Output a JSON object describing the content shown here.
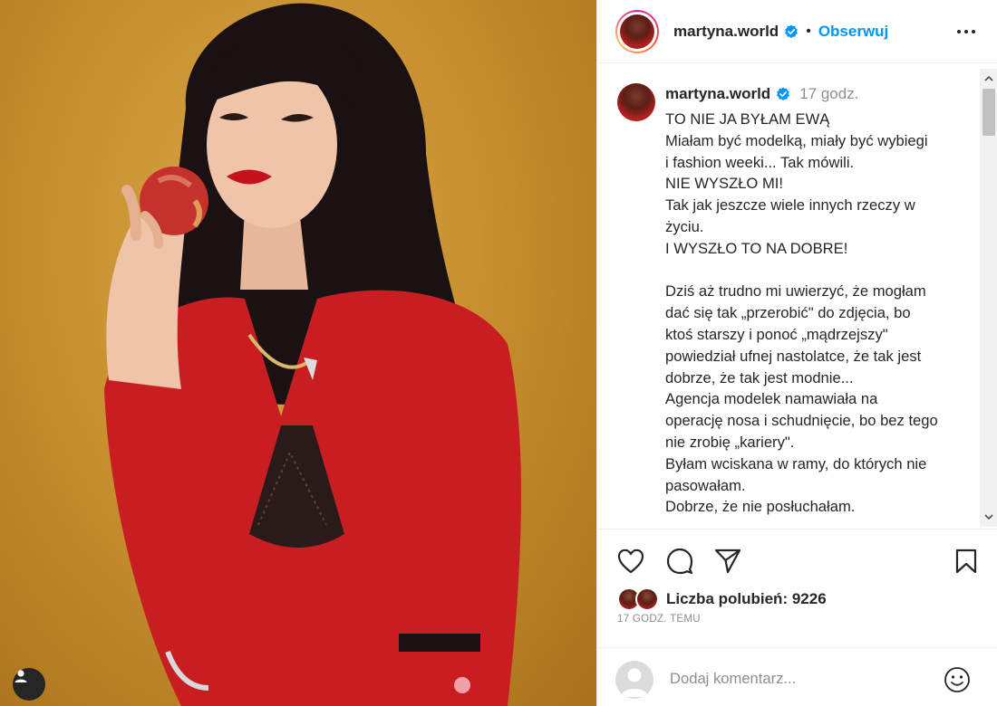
{
  "post": {
    "username": "martyna.world",
    "follow_label": "Obserwuj",
    "separator": "•"
  },
  "caption": {
    "username": "martyna.world",
    "time": "17 godz.",
    "lines": [
      "TO NIE JA BYŁAM EWĄ",
      "Miałam być modelką, miały być wybiegi",
      "i fashion weeki... Tak mówili.",
      "NIE WYSZŁO MI!",
      "Tak jak jeszcze wiele innych rzeczy w",
      "życiu.",
      "I WYSZŁO TO NA DOBRE!",
      "",
      "Dziś aż trudno mi uwierzyć, że mogłam",
      "dać się tak „przerobić\" do zdjęcia, bo",
      "ktoś starszy i ponoć „mądrzejszy\"",
      "powiedział ufnej nastolatce, że tak jest",
      "dobrze, że tak jest modnie...",
      "Agencja modelek namawiała na",
      "operację nosa i schudnięcie, bo bez tego",
      "nie zrobię „kariery\".",
      "Byłam wciskana w ramy, do których nie",
      "pasowałam.",
      "Dobrze, że nie posłuchałam."
    ]
  },
  "likes": {
    "label": "Liczba polubień: 9226"
  },
  "timestamp": "17 GODZ. TEMU",
  "comment": {
    "placeholder": "Dodaj komentarz..."
  },
  "icons": {
    "like": "heart-icon",
    "comment": "comment-bubble-icon",
    "share": "send-icon",
    "save": "bookmark-icon",
    "more": "more-options-icon",
    "emoji": "emoji-icon",
    "user_tag": "user-tag-icon",
    "verified": "verified-badge-icon"
  },
  "colors": {
    "accent": "#0095f6",
    "verified": "#0095f6",
    "muted": "#8e8e8e",
    "backdrop": "#c8902f",
    "blazer": "#c81e22"
  }
}
